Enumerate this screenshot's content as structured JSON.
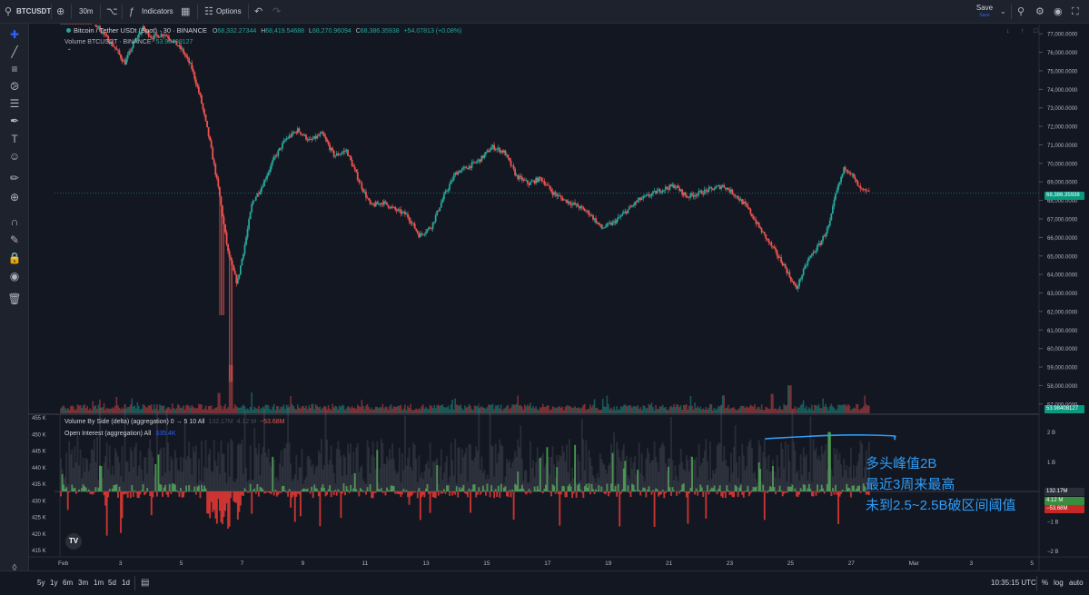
{
  "toolbar": {
    "symbol": "BTCUSDT",
    "interval": "30m",
    "indicators": "Indicators",
    "options": "Options",
    "save": "Save",
    "save_sub": "Save",
    "icons": [
      "search-icon",
      "add-symbol-icon",
      "bar-style-icon",
      "indicators-icon",
      "layout-icon",
      "options-icon",
      "undo-icon",
      "redo-icon",
      "chevron-down-icon",
      "quick-search-icon",
      "settings-icon",
      "camera-icon",
      "fullscreen-icon"
    ]
  },
  "legend": {
    "title": "Bitcoin / Tether USDt (Spot) · 30 · BINANCE",
    "open": "68,332.27344",
    "high": "68,419.54688",
    "low": "68,270.96094",
    "close": "68,386.35938",
    "change": "+54.07813 (+0.08%)",
    "open_label": "O",
    "high_label": "H",
    "low_label": "L",
    "close_label": "C",
    "volume_label": "Volume BTCUSDT · BINANCE",
    "volume_value": "53.98408127",
    "vbs_label": "Volume By Side (delta) (aggregation) 0 → 5 10 All",
    "vbs_v1": "132.17M",
    "vbs_v2": "4.12 M",
    "vbs_v3": "−53.68M",
    "oi_label": "Open Interest (aggregation) All",
    "oi_value": "335.4K"
  },
  "annotation": {
    "line1": "多头峰值2B",
    "line2": "最近3周来最高",
    "line3": "未到2.5~2.5B破区间阈值"
  },
  "tags": {
    "price": "68,386.35938",
    "volume": "53.98408127",
    "delta_pos": "132.17M",
    "delta_mid": "4.12 M",
    "delta_neg": "−53.68M"
  },
  "bottombar": {
    "ranges": [
      "5y",
      "1y",
      "6m",
      "3m",
      "1m",
      "5d",
      "1d"
    ],
    "time": "10:35:15 UTC",
    "pct": "%",
    "log": "log",
    "auto": "auto"
  },
  "colors": {
    "up": "#26a69a",
    "down": "#ef5350",
    "bg": "#131722",
    "delta_pos": "#4caf50",
    "delta_neg": "#e53935",
    "price_tag": "#089981",
    "annotation": "#2f9cf5"
  },
  "chart_data": [
    {
      "type": "candlestick",
      "title": "Bitcoin / Tether USDt (Spot) · 30 · BINANCE",
      "x_ticks": [
        "Feb",
        "3",
        "5",
        "7",
        "9",
        "11",
        "13",
        "15",
        "17",
        "19",
        "21",
        "23",
        "25",
        "27",
        "Mar",
        "3",
        "5"
      ],
      "y_ticks": [
        "77,000.0000",
        "76,000.0000",
        "75,000.0000",
        "74,000.0000",
        "73,000.0000",
        "72,000.0000",
        "71,000.0000",
        "70,000.0000",
        "69,000.0000",
        "68,000.0000",
        "67,000.0000",
        "66,000.0000",
        "65,000.0000",
        "64,000.0000",
        "63,000.0000",
        "62,000.0000",
        "61,000.0000",
        "60,000.0000",
        "59,000.0000",
        "58,000.0000",
        "57,000.0000"
      ],
      "ylim": [
        56500,
        77500
      ],
      "path_day": [
        0.0,
        0.8,
        1.2,
        1.5,
        1.8,
        2.1,
        2.4,
        2.7,
        3.0,
        3.4,
        3.7,
        4.0,
        4.3,
        4.6,
        4.9,
        5.2,
        5.5,
        5.8,
        6.1,
        6.3,
        6.6,
        7.0,
        7.4,
        7.8,
        8.2,
        8.6,
        9.0,
        9.4,
        9.8,
        10.2,
        10.6,
        11.0,
        11.4,
        11.8,
        12.2,
        12.6,
        13.0,
        13.4,
        13.8,
        14.2,
        14.6,
        15.0,
        15.4,
        15.8,
        16.2,
        16.6,
        17.0,
        17.4,
        17.8,
        18.2,
        18.6,
        19.0,
        19.4,
        19.8,
        20.2,
        20.6,
        21.0,
        21.4,
        21.8,
        22.2,
        22.6,
        23.0,
        23.4,
        23.8,
        24.2,
        24.6,
        25.0,
        25.3,
        25.5,
        25.8,
        26.0,
        26.3,
        26.6
      ],
      "path_close": [
        78800,
        78000,
        77400,
        76800,
        76200,
        75400,
        76500,
        77300,
        76800,
        77000,
        76600,
        76100,
        75200,
        73500,
        71200,
        68500,
        65200,
        63500,
        66000,
        67900,
        68700,
        70200,
        71300,
        71800,
        71200,
        71600,
        70400,
        70700,
        69100,
        67700,
        67900,
        67500,
        67200,
        66100,
        66600,
        68200,
        69500,
        69800,
        70200,
        70900,
        70600,
        69300,
        68900,
        69200,
        68400,
        68000,
        67700,
        67300,
        66500,
        66800,
        67400,
        68000,
        68300,
        68600,
        68800,
        68200,
        68400,
        68600,
        68800,
        68300,
        67600,
        66500,
        65500,
        64500,
        63200,
        64800,
        65700,
        66700,
        68300,
        69800,
        69500,
        68600,
        68400
      ],
      "volume_ylim": [
        0,
        2500
      ],
      "volume_spikes": [
        {
          "day": 5.6,
          "value": 1900
        },
        {
          "day": 5.2,
          "value": 800
        },
        {
          "day": 24.0,
          "value": 1100
        },
        {
          "day": 21.8,
          "value": 700
        }
      ]
    },
    {
      "type": "area",
      "title": "Volume By Side (delta) (aggregation)",
      "y_ticks_right": [
        "2 B",
        "1 B",
        "−1 B",
        "−2 B"
      ],
      "ylim": [
        -2200000000,
        2600000000
      ],
      "series": [
        {
          "name": "Volume By Side (delta)",
          "values_unit": "USD",
          "peak_day": 25.3,
          "peak_value": 2000000000
        }
      ]
    },
    {
      "type": "area",
      "title": "Open Interest (aggregation)",
      "y_ticks_left": [
        "455 K",
        "450 K",
        "445 K",
        "440 K",
        "435 K",
        "430 K",
        "425 K",
        "420 K",
        "415 K"
      ],
      "ylim": [
        413000,
        456000
      ]
    }
  ]
}
